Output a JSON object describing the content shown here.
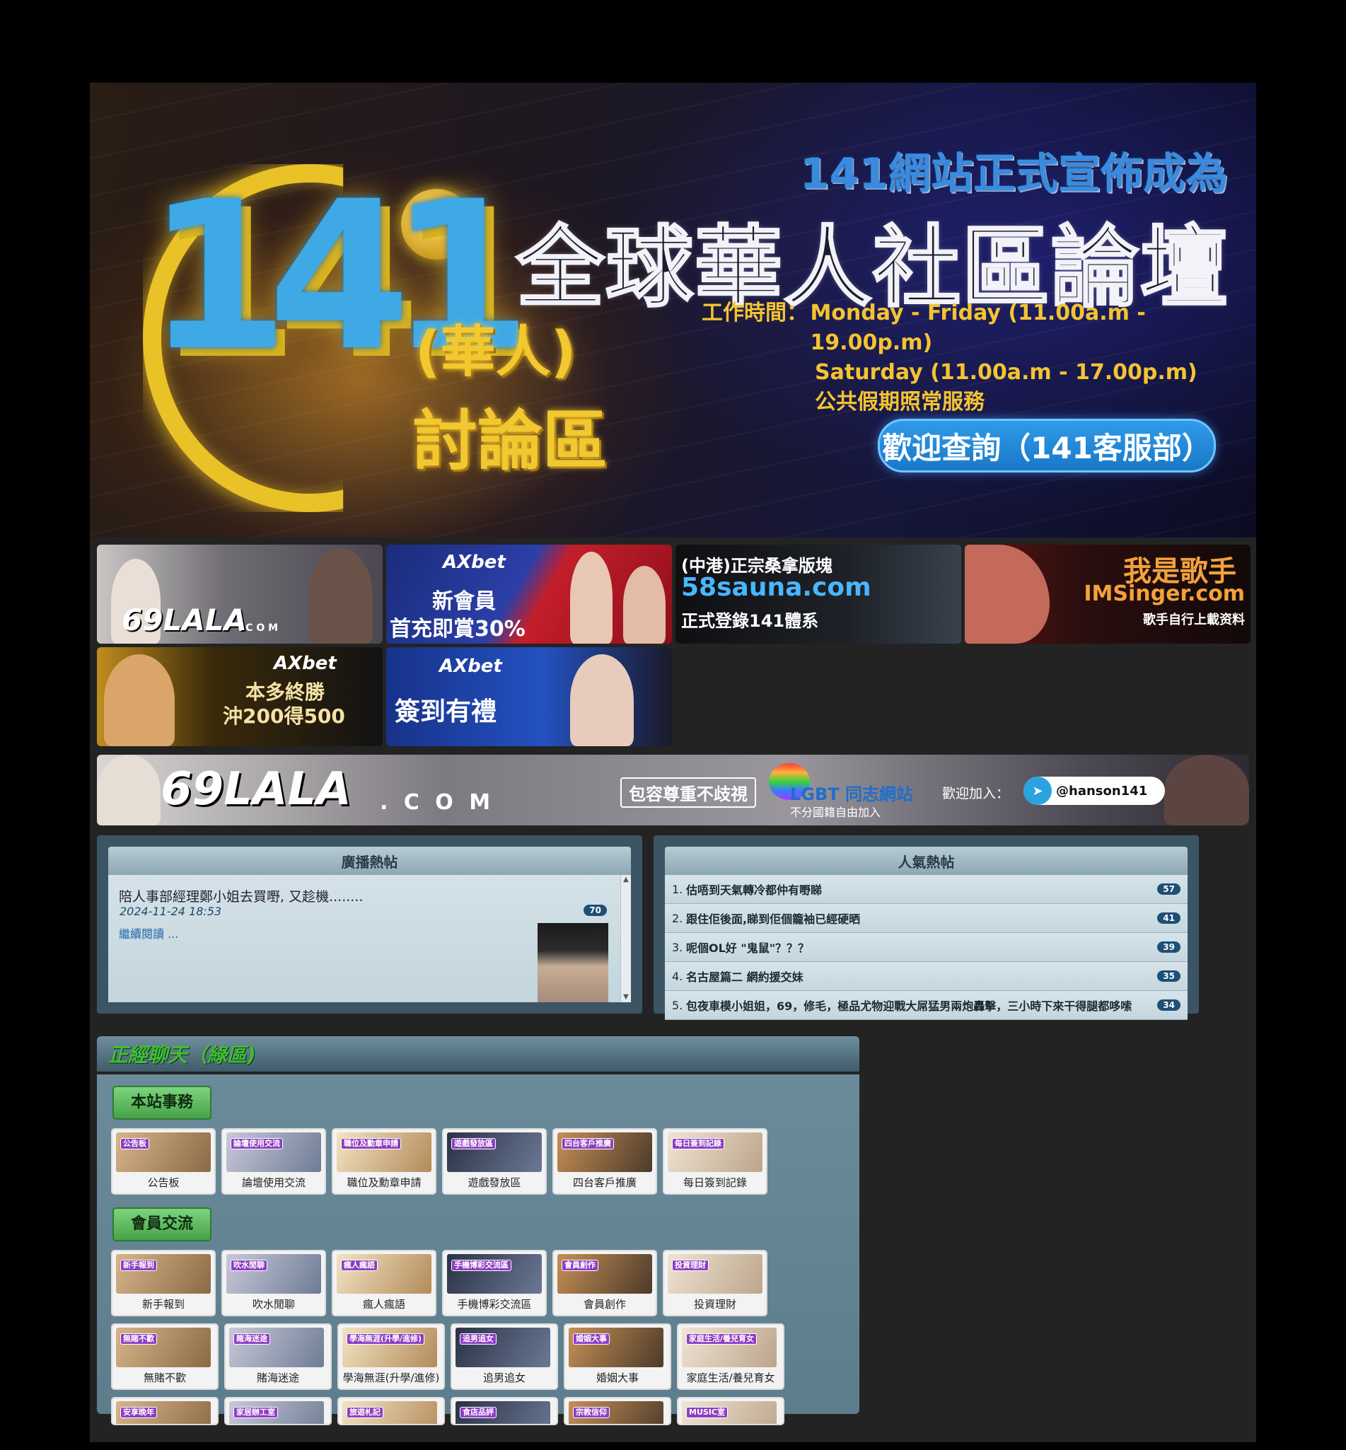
{
  "hero": {
    "logo_number": "141",
    "logo_cn_1": "(華人)",
    "logo_cn_2": "討論區",
    "headline_1": "141網站正式宣佈成為",
    "headline_2": "全球華人社區論壇",
    "hours_label": "工作時間：",
    "hours_line_1": "Monday - Friday (11.00a.m - 19.00p.m)",
    "hours_line_2": "Saturday (11.00a.m - 17.00p.m)",
    "hours_line_3": "公共假期照常服務",
    "cta": "歡迎查詢（141客服部）"
  },
  "ads": [
    {
      "line1": "69LALA",
      "line2": ". C O M"
    },
    {
      "brand": "AXbet",
      "line1": "新會員",
      "line2": "首充即賞30%"
    },
    {
      "line1": "(中港)正宗桑拿版塊",
      "line2": "58sauna.com",
      "line3": "正式登錄141體系"
    },
    {
      "line1": "我是歌手",
      "line2": "IMSinger.com",
      "line3": "歌手自行上載资料"
    },
    {
      "brand": "AXbet",
      "line1": "本多終勝",
      "line2": "沖200得500"
    },
    {
      "brand": "AXbet",
      "line1": "簽到有禮"
    }
  ],
  "wide_ad": {
    "logo": "69LALA",
    "dotcom": ". C O M",
    "slogan": "包容尊重不歧視",
    "lgbt": "LGBT 同志網站",
    "lgbt_sub": "不分國籍自由加入",
    "join": "歡迎加入：",
    "handle": "@hanson141"
  },
  "broadcast": {
    "title": "廣播熱帖",
    "post_title": "陪人事部經理鄭小姐去買嘢, 又趁機........",
    "post_date": "2024-11-24 18:53",
    "read_more": "繼續閱讀 ...",
    "count": "70"
  },
  "popular": {
    "title": "人氣熱帖",
    "items": [
      {
        "num": "1.",
        "title": "估唔到天氣轉冷都仲有嘢睇",
        "count": "57"
      },
      {
        "num": "2.",
        "title": "跟住佢後面,睇到佢個籠袖已經硬晒",
        "count": "41"
      },
      {
        "num": "3.",
        "title": "呢個OL好 \"鬼鼠\"？？？",
        "count": "39"
      },
      {
        "num": "4.",
        "title": "名古屋篇二 網約援交妹",
        "count": "35"
      },
      {
        "num": "5.",
        "title": "包夜車模小姐姐，69，修毛，極品尤物迎戰大屌猛男兩炮轟擊，三小時下來干得腿都哆嗦",
        "count": "34"
      }
    ]
  },
  "section": {
    "title": "正經聊天（綠區)",
    "cat1": "本站事務",
    "cat1_tiles": [
      {
        "tag": "公告板",
        "label": "公告板"
      },
      {
        "tag": "論壇使用交流",
        "label": "論壇使用交流"
      },
      {
        "tag": "職位及勳章申請",
        "label": "職位及勳章申請"
      },
      {
        "tag": "遊戲發放區",
        "label": "遊戲發放區"
      },
      {
        "tag": "四台客戶推廣",
        "label": "四台客戶推廣"
      },
      {
        "tag": "每日簽到記錄",
        "label": "每日簽到記錄"
      }
    ],
    "cat2": "會員交流",
    "cat2_tiles": [
      {
        "tag": "新手報到",
        "label": "新手報到"
      },
      {
        "tag": "吹水閒聊",
        "label": "吹水閒聊"
      },
      {
        "tag": "瘋人瘋語",
        "label": "瘋人瘋語"
      },
      {
        "tag": "手機博彩交流區",
        "label": "手機博彩交流區"
      },
      {
        "tag": "會員創作",
        "label": "會員創作"
      },
      {
        "tag": "投資理財",
        "label": "投資理財"
      }
    ],
    "cat2_tiles_2": [
      {
        "tag": "無賭不歡",
        "label": "無賭不歡"
      },
      {
        "tag": "賭海迷途",
        "label": "賭海迷途"
      },
      {
        "tag": "學海無涯(升學/進修)",
        "label": "學海無涯(升學/進修)"
      },
      {
        "tag": "追男追女",
        "label": "追男追女"
      },
      {
        "tag": "婚姻大事",
        "label": "婚姻大事"
      },
      {
        "tag": "家庭生活/養兒育女",
        "label": "家庭生活/養兒育女"
      }
    ],
    "cat2_tiles_3": [
      {
        "tag": "安享晚年"
      },
      {
        "tag": "家居辦工室"
      },
      {
        "tag": "旅遊札記"
      },
      {
        "tag": "食店品評"
      },
      {
        "tag": "宗教信仰"
      },
      {
        "tag": "MUSIC室"
      }
    ]
  }
}
